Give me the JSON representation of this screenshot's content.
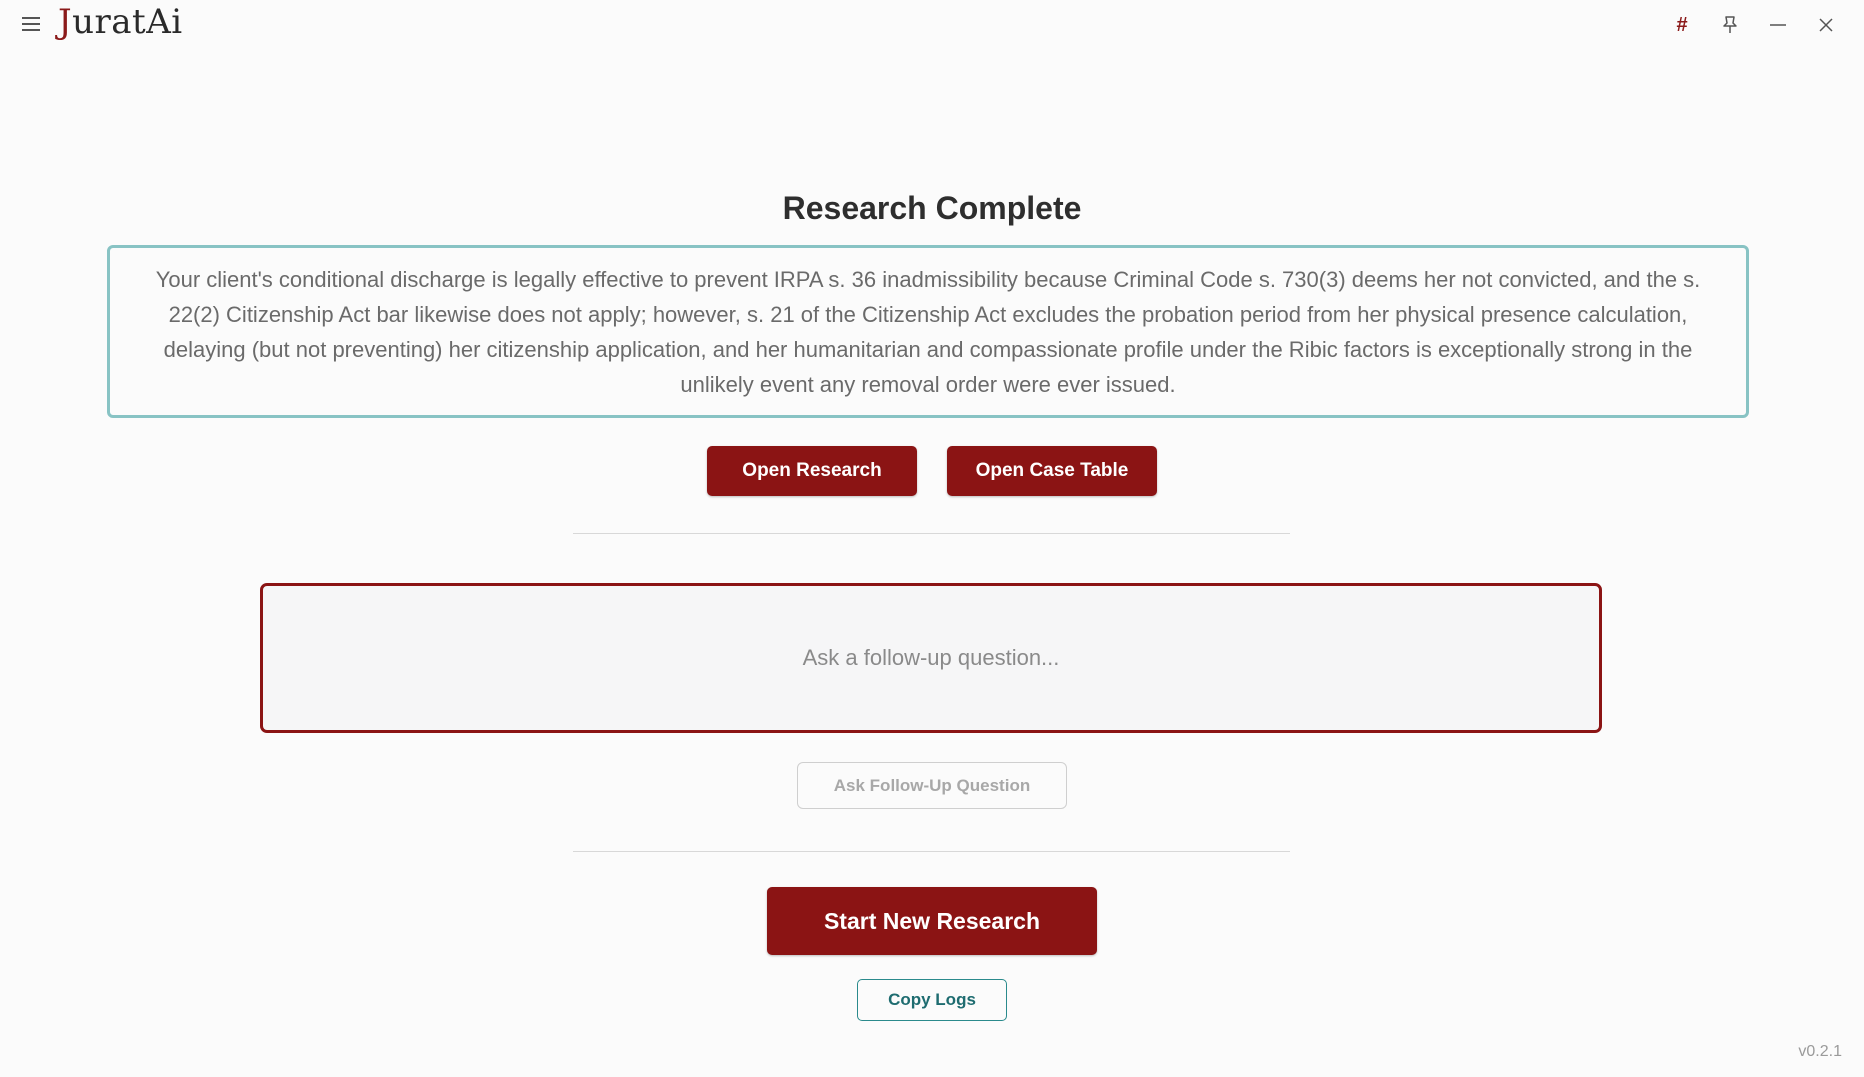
{
  "app": {
    "brand_first_letter": "J",
    "brand_rest": "uratAi",
    "version": "v0.2.1"
  },
  "titlebar": {
    "hash_symbol": "#",
    "minimize_symbol": "—",
    "close_symbol": "✕"
  },
  "main": {
    "heading": "Research Complete",
    "summary": "Your client's conditional discharge is legally effective to prevent IRPA s. 36 inadmissibility because Criminal Code s. 730(3) deems her not convicted, and the s. 22(2) Citizenship Act bar likewise does not apply; however, s. 21 of the Citizenship Act excludes the probation period from her physical presence calculation, delaying (but not preventing) her citizenship application, and her humanitarian and compassionate profile under the Ribic factors is exceptionally strong in the unlikely event any removal order were ever issued.",
    "open_research_label": "Open Research",
    "open_case_table_label": "Open Case Table",
    "followup_placeholder": "Ask a follow-up question...",
    "followup_value": "",
    "ask_followup_label": "Ask Follow-Up Question",
    "start_new_label": "Start New Research",
    "copy_logs_label": "Copy Logs"
  },
  "colors": {
    "accent": "#8b1414",
    "teal": "#88c3c4",
    "teal_text": "#1e6c70"
  },
  "icons": {
    "menu": "menu-icon",
    "hash": "hash-icon",
    "pin": "pin-icon",
    "minimize": "minimize-icon",
    "close": "close-icon"
  }
}
